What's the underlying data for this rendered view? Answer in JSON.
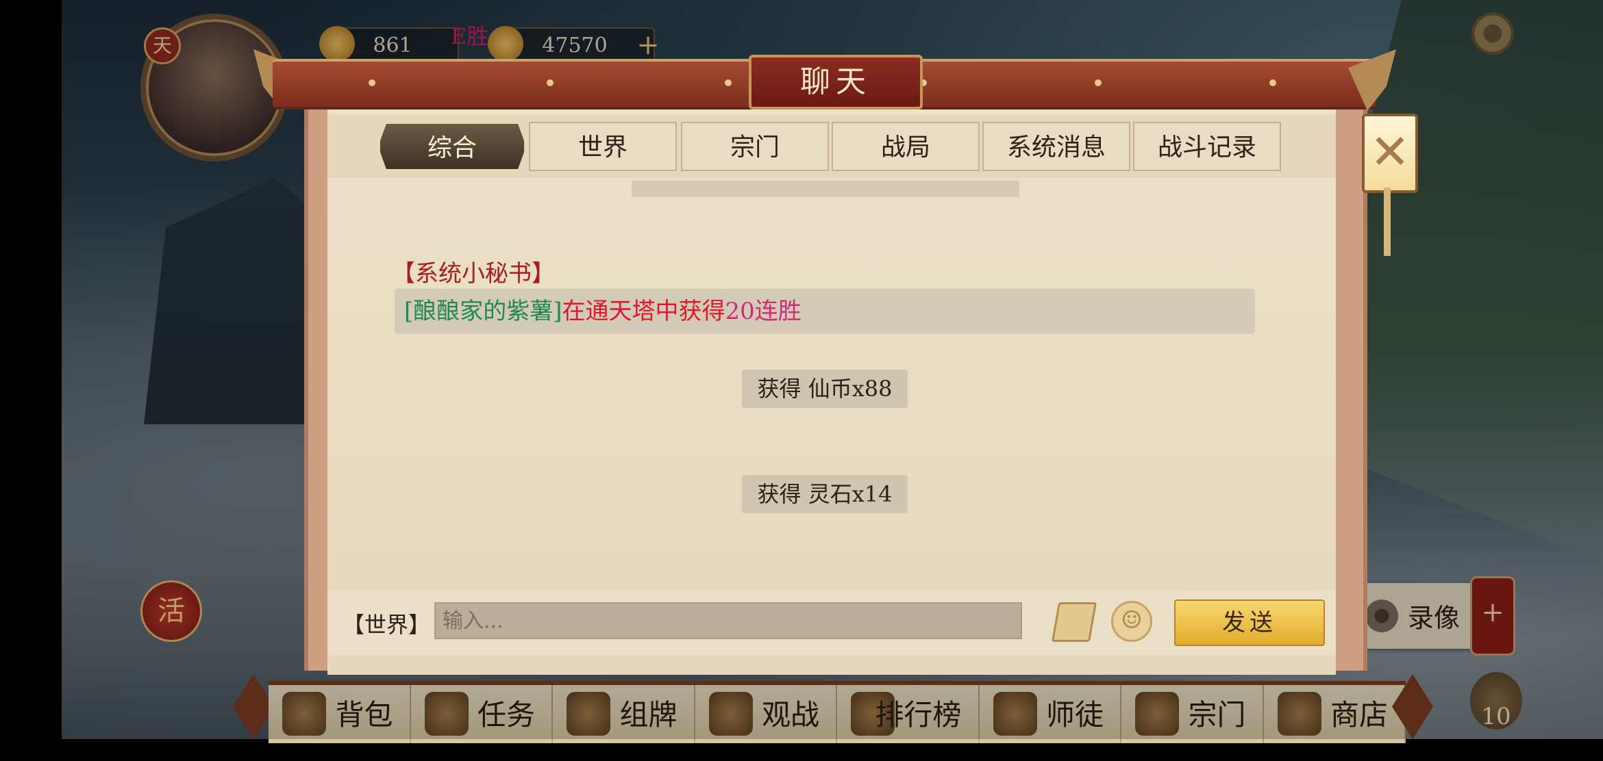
{
  "hud": {
    "currency_gold": "861",
    "currency_coin": "47570",
    "victory_text": "E胜",
    "avatar_badge": "天"
  },
  "side": {
    "activity_badge": "活",
    "record_label": "录像",
    "record_plus": "+",
    "bag_count": "10"
  },
  "panel": {
    "title": "聊天",
    "close_symbol": "✕",
    "tabs": [
      {
        "label": "综合",
        "active": true
      },
      {
        "label": "世界"
      },
      {
        "label": "宗门"
      },
      {
        "label": "战局"
      },
      {
        "label": "系统消息"
      },
      {
        "label": "战斗记录"
      }
    ],
    "messages": {
      "sender": "【系统小秘书】",
      "player_name": "[酿酿家的紫薯]",
      "text_mid": "在通天塔中获得",
      "text_num": "20连胜"
    },
    "rewards": [
      "获得 仙币x88",
      "获得 灵石x14"
    ],
    "channel_label": "【世界】",
    "input_placeholder": "输入...",
    "send_label": "发送"
  },
  "bottom_nav": [
    {
      "label": "背包"
    },
    {
      "label": "任务"
    },
    {
      "label": "组牌"
    },
    {
      "label": "观战"
    },
    {
      "label": "排行榜"
    },
    {
      "label": "师徒"
    },
    {
      "label": "宗门"
    },
    {
      "label": "商店"
    }
  ],
  "colors": {
    "sender": "#a41f1f",
    "player_name": "#1f8a4c",
    "highlight": "#e0162e",
    "win_streak": "#d22a7a",
    "send_button": "#e9bb3e"
  }
}
